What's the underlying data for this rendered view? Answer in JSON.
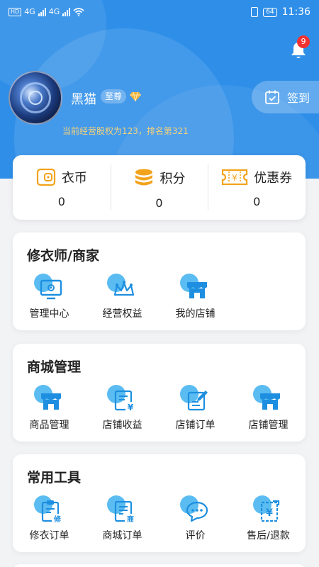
{
  "status_bar": {
    "net1": "4G",
    "net2": "4G",
    "battery": "64",
    "time": "11:36"
  },
  "header": {
    "notification_count": "9",
    "username": "黑猫",
    "vip_level": "至尊",
    "equity_text": "当前经营股权为123，排名第321",
    "signin_label": "签到"
  },
  "stats": [
    {
      "label": "衣币",
      "value": "0",
      "icon": "coin-card-icon"
    },
    {
      "label": "积分",
      "value": "0",
      "icon": "points-stack-icon"
    },
    {
      "label": "优惠券",
      "value": "0",
      "icon": "coupon-icon"
    }
  ],
  "sections": {
    "tailor": {
      "title": "修衣师/商家",
      "items": [
        {
          "label": "管理中心",
          "icon": "monitor-gear-icon"
        },
        {
          "label": "经营权益",
          "icon": "crown-icon"
        },
        {
          "label": "我的店铺",
          "icon": "store-icon"
        }
      ]
    },
    "mall": {
      "title": "商城管理",
      "items": [
        {
          "label": "商品管理",
          "icon": "store-icon"
        },
        {
          "label": "店铺收益",
          "icon": "income-doc-icon"
        },
        {
          "label": "店铺订单",
          "icon": "order-edit-icon"
        },
        {
          "label": "店铺管理",
          "icon": "store-icon"
        }
      ]
    },
    "tools": {
      "title": "常用工具",
      "items": [
        {
          "label": "修衣订单",
          "icon": "repair-order-icon"
        },
        {
          "label": "商城订单",
          "icon": "mall-order-icon"
        },
        {
          "label": "评价",
          "icon": "comment-icon"
        },
        {
          "label": "售后/退款",
          "icon": "refund-icon"
        }
      ]
    }
  },
  "colors": {
    "header_blue": "#2f8fe8",
    "icon_blue": "#1e8fe0",
    "icon_light_blue": "#5bbcf2",
    "gold": "#f2a31b",
    "badge_red": "#f23131",
    "equity_text": "#f6d27a"
  }
}
